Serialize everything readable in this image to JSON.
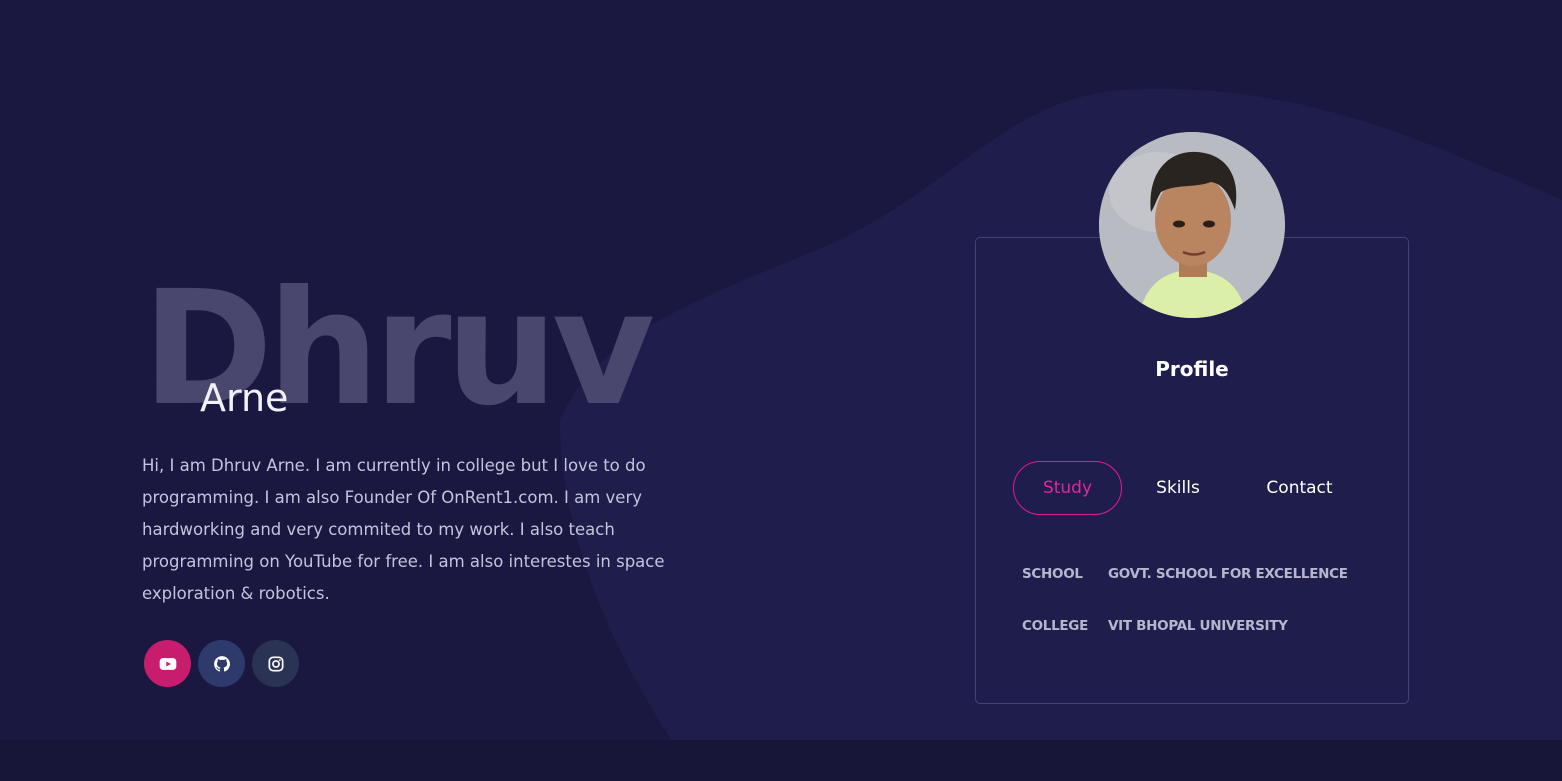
{
  "hero": {
    "first_name": "Dhruv",
    "last_name": "Arne",
    "bio": "Hi, I am Dhruv Arne. I am currently in college but I love to do programming. I am also Founder Of OnRent1.com. I am very hardworking and very commited to my work. I also teach programming on YouTube for free. I am also interestes in space exploration & robotics."
  },
  "socials": [
    {
      "icon": "youtube-icon",
      "color": "#c81d6e"
    },
    {
      "icon": "github-icon",
      "color": "#2e3a6b"
    },
    {
      "icon": "instagram-icon",
      "color": "#2b3354"
    }
  ],
  "profile": {
    "title": "Profile",
    "tabs": [
      {
        "label": "Study",
        "active": true
      },
      {
        "label": "Skills",
        "active": false
      },
      {
        "label": "Contact",
        "active": false
      }
    ],
    "study": [
      {
        "key": "SCHOOL",
        "value": "GOVT. SCHOOL FOR EXCELLENCE"
      },
      {
        "key": "COLLEGE",
        "value": "VIT BHOPAL UNIVERSITY"
      }
    ]
  },
  "colors": {
    "background": "#1a1840",
    "accent": "#e11d8f",
    "card_border": "#3b4675"
  }
}
